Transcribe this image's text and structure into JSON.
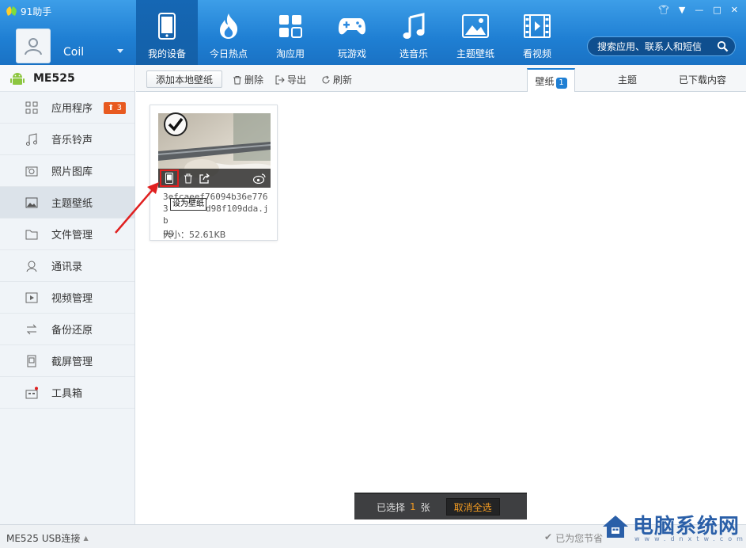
{
  "app": {
    "title": "91助手"
  },
  "user": {
    "name": "Coil"
  },
  "nav": [
    {
      "label": "我的设备",
      "icon": "phone-icon",
      "active": true
    },
    {
      "label": "今日热点",
      "icon": "flame-icon"
    },
    {
      "label": "淘应用",
      "icon": "apps-grid-icon"
    },
    {
      "label": "玩游戏",
      "icon": "gamepad-icon"
    },
    {
      "label": "选音乐",
      "icon": "music-note-icon"
    },
    {
      "label": "主题壁纸",
      "icon": "picture-icon"
    },
    {
      "label": "看视频",
      "icon": "film-icon"
    }
  ],
  "search": {
    "placeholder": "搜索应用、联系人和短信"
  },
  "device": {
    "name": "ME525"
  },
  "sidebar": {
    "items": [
      {
        "label": "应用程序",
        "icon": "apps-icon",
        "badge": "3"
      },
      {
        "label": "音乐铃声",
        "icon": "music-icon"
      },
      {
        "label": "照片图库",
        "icon": "photo-icon"
      },
      {
        "label": "主题壁纸",
        "icon": "wallpaper-icon",
        "active": true
      },
      {
        "label": "文件管理",
        "icon": "folder-icon"
      },
      {
        "label": "通讯录",
        "icon": "contacts-icon"
      },
      {
        "label": "视频管理",
        "icon": "video-icon"
      },
      {
        "label": "备份还原",
        "icon": "backup-icon"
      },
      {
        "label": "截屏管理",
        "icon": "screenshot-icon"
      },
      {
        "label": "工具箱",
        "icon": "toolbox-icon"
      }
    ]
  },
  "toolbar": {
    "add_label": "添加本地壁纸",
    "delete_label": "删除",
    "export_label": "导出",
    "refresh_label": "刷新"
  },
  "tabs": [
    {
      "label": "壁纸",
      "badge": "1",
      "active": true
    },
    {
      "label": "主题"
    },
    {
      "label": "已下载内容"
    }
  ],
  "wallpaper": {
    "filename": "3efcaeef76094b36e7763b8d98f109dda.jpg",
    "filename_lines": [
      "3efcaeef76094b36e7763",
      "b",
      "d98f109dda.j",
      "pg"
    ],
    "size_label": "大小：52.61KB",
    "tooltip": "设为壁纸"
  },
  "selection": {
    "prefix": "已选择",
    "count": "1",
    "suffix": "张",
    "cancel_label": "取消全选"
  },
  "status": {
    "device": "ME525",
    "connection": "USB连接",
    "right_text": "已为您节省"
  },
  "watermark": {
    "text": "电脑系统网",
    "url": "www.dnxtw.com"
  },
  "colors": {
    "accent": "#1f7fd3",
    "badge": "#e85a20",
    "highlight": "#e02020",
    "selected_count": "#f29b22"
  }
}
